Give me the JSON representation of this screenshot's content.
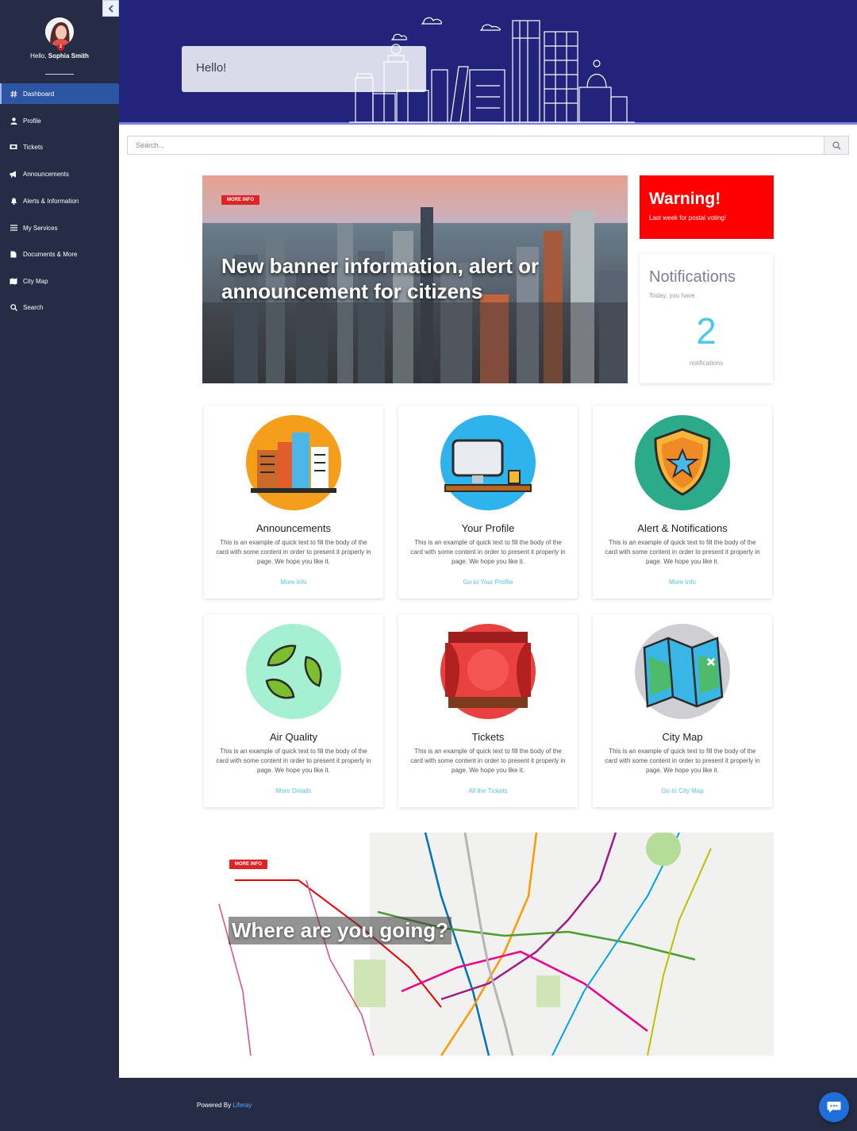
{
  "sidebar": {
    "greeting_prefix": "Hello,",
    "user_name": "Sophia Smith",
    "notification_badge": "2",
    "items": [
      {
        "label": "Dashboard",
        "icon": "hash-icon",
        "active": true
      },
      {
        "label": "Profile",
        "icon": "user-icon"
      },
      {
        "label": "Tickets",
        "icon": "ticket-icon"
      },
      {
        "label": "Announcements",
        "icon": "megaphone-icon"
      },
      {
        "label": "Alerts & Information",
        "icon": "bell-icon"
      },
      {
        "label": "My Services",
        "icon": "list-icon"
      },
      {
        "label": "Documents & More",
        "icon": "document-icon"
      },
      {
        "label": "City Map",
        "icon": "map-icon"
      },
      {
        "label": "Search",
        "icon": "search-icon"
      }
    ]
  },
  "header": {
    "hello": "Hello!"
  },
  "search": {
    "placeholder": "Search..."
  },
  "banner": {
    "tag": "MORE INFO",
    "title": "New banner information, alert or announcement for citizens"
  },
  "warning": {
    "title": "Warning!",
    "text": "Last week for postal voting!"
  },
  "notifications": {
    "title": "Notifications",
    "subtitle": "Today, you have",
    "count": "2",
    "label": "notifications"
  },
  "cards": [
    {
      "title": "Announcements",
      "text": "This is an example of quick text to fill the body of the card with some content in order to present it properly in page. We hope you like it.",
      "link": "More info"
    },
    {
      "title": "Your Profile",
      "text": "This is an example of quick text to fill the body of the card with some content in order to present it properly in page. We hope you like it.",
      "link": "Go to Your Profile"
    },
    {
      "title": "Alert & Notifications",
      "text": "This is an example of quick text to fill the body of the card with some content in order to present it properly in page. We hope you like it.",
      "link": "More Info"
    },
    {
      "title": "Air Quality",
      "text": "This is an example of quick text to fill the body of the card with some content in order to present it properly in page. We hope you like it.",
      "link": "More Details"
    },
    {
      "title": "Tickets",
      "text": "This is an example of quick text to fill the body of the card with some content in order to present it properly in page. We hope you like it.",
      "link": "All the Tickets"
    },
    {
      "title": "City Map",
      "text": "This is an example of quick text to fill the body of the card with some content in order to present it properly in page. We hope you like it.",
      "link": "Go to City Map"
    }
  ],
  "map_banner": {
    "tag": "MORE INFO",
    "title": "Where are you going?"
  },
  "footer": {
    "powered_by": "Powered By",
    "link": "Liferay"
  },
  "colors": {
    "sidebar_bg": "#262c45",
    "header_bg": "#22237a",
    "active_nav": "#2c55a3",
    "warning": "#ff0000",
    "accent": "#4ec8e6"
  }
}
